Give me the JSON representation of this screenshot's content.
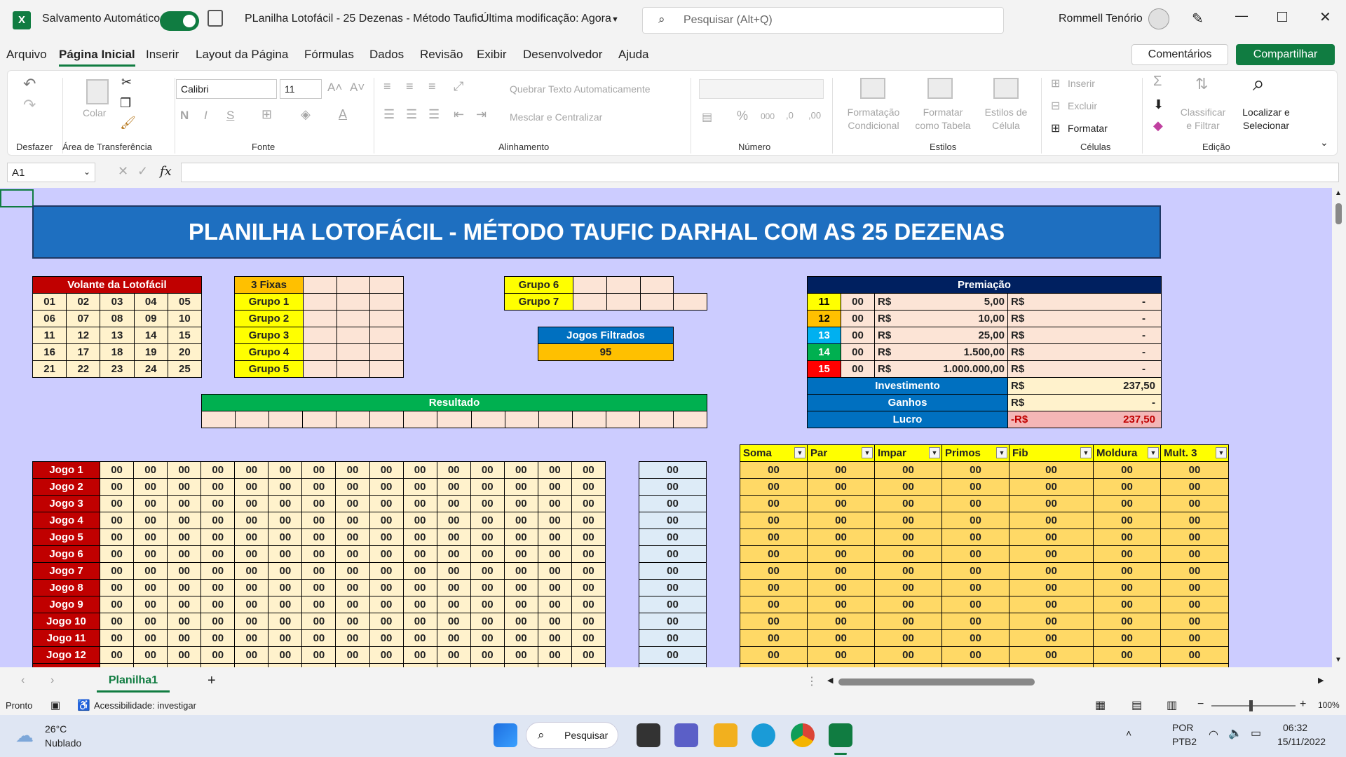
{
  "titlebar": {
    "autosave_label": "Salvamento Automático",
    "doc_title": "PLanilha Lotofácil - 25 Dezenas - Método Taufic",
    "modified": "Última modificação: Agora",
    "search_placeholder": "Pesquisar (Alt+Q)",
    "user": "Rommell Tenório",
    "excel_letter": "X"
  },
  "menu": {
    "items": [
      "Arquivo",
      "Página Inicial",
      "Inserir",
      "Layout da Página",
      "Fórmulas",
      "Dados",
      "Revisão",
      "Exibir",
      "Desenvolvedor",
      "Ajuda"
    ],
    "comments": "Comentários",
    "share": "Compartilhar"
  },
  "ribbon": {
    "undo_label": "Desfazer",
    "clipboard_label": "Área de Transferência",
    "paste": "Colar",
    "font_label": "Fonte",
    "font_name": "Calibri",
    "font_size": "11",
    "align_label": "Alinhamento",
    "wrap": "Quebrar Texto Automaticamente",
    "merge": "Mesclar e Centralizar",
    "number_label": "Número",
    "styles_label": "Estilos",
    "cond_fmt": "Formatação Condicional",
    "fmt_table": "Formatar como Tabela",
    "cell_styles": "Estilos de Célula",
    "cells_label": "Células",
    "insert": "Inserir",
    "delete": "Excluir",
    "format": "Formatar",
    "edit_label": "Edição",
    "sort": "Classificar e Filtrar",
    "find": "Localizar e Selecionar"
  },
  "formula": {
    "namebox": "A1",
    "fx": "fx"
  },
  "sheet": {
    "title": "PLANILHA LOTOFÁCIL - MÉTODO TAUFIC DARHAL COM AS 25 DEZENAS",
    "volante": {
      "header": "Volante da Lotofácil",
      "rows": [
        [
          "01",
          "02",
          "03",
          "04",
          "05"
        ],
        [
          "06",
          "07",
          "08",
          "09",
          "10"
        ],
        [
          "11",
          "12",
          "13",
          "14",
          "15"
        ],
        [
          "16",
          "17",
          "18",
          "19",
          "20"
        ],
        [
          "21",
          "22",
          "23",
          "24",
          "25"
        ]
      ]
    },
    "groups": [
      "3 Fixas",
      "Grupo 1",
      "Grupo 2",
      "Grupo 3",
      "Grupo 4",
      "Grupo 5"
    ],
    "groups2": [
      "Grupo 6",
      "Grupo 7"
    ],
    "filtrados": {
      "label": "Jogos Filtrados",
      "value": "95"
    },
    "resultado": "Resultado",
    "premiacao": {
      "header": "Premiação",
      "rows": [
        {
          "hits": "11",
          "count": "00",
          "cur": "R$",
          "prize": "5,00",
          "cur2": "R$",
          "total": "-",
          "color": "#ffff00",
          "fg": "#000"
        },
        {
          "hits": "12",
          "count": "00",
          "cur": "R$",
          "prize": "10,00",
          "cur2": "R$",
          "total": "-",
          "color": "#ffc000",
          "fg": "#000"
        },
        {
          "hits": "13",
          "count": "00",
          "cur": "R$",
          "prize": "25,00",
          "cur2": "R$",
          "total": "-",
          "color": "#00b0f0",
          "fg": "#fff"
        },
        {
          "hits": "14",
          "count": "00",
          "cur": "R$",
          "prize": "1.500,00",
          "cur2": "R$",
          "total": "-",
          "color": "#00b050",
          "fg": "#fff"
        },
        {
          "hits": "15",
          "count": "00",
          "cur": "R$",
          "prize": "1.000.000,00",
          "cur2": "R$",
          "total": "-",
          "color": "#ff0000",
          "fg": "#fff"
        }
      ],
      "invest": {
        "label": "Investimento",
        "cur": "R$",
        "value": "237,50"
      },
      "ganhos": {
        "label": "Ganhos",
        "cur": "R$",
        "value": "-"
      },
      "lucro": {
        "label": "Lucro",
        "cur": "-R$",
        "value": "237,50"
      }
    },
    "stats_headers": [
      "Soma",
      "Par",
      "Impar",
      "Primos",
      "Fib",
      "Moldura",
      "Mult. 3"
    ],
    "zero": "00",
    "jogos": [
      "Jogo 1",
      "Jogo 2",
      "Jogo 3",
      "Jogo 4",
      "Jogo 5",
      "Jogo 6",
      "Jogo 7",
      "Jogo 8",
      "Jogo 9",
      "Jogo 10",
      "Jogo 11",
      "Jogo 12"
    ]
  },
  "tabs": {
    "sheet": "Planilha1",
    "add": "+"
  },
  "status": {
    "ready": "Pronto",
    "accessibility": "Acessibilidade: investigar",
    "zoom": "100%"
  },
  "taskbar": {
    "temp": "26°C",
    "weather": "Nublado",
    "search": "Pesquisar",
    "lang": "POR",
    "layout": "PTB2",
    "time": "06:32",
    "date": "15/11/2022"
  }
}
